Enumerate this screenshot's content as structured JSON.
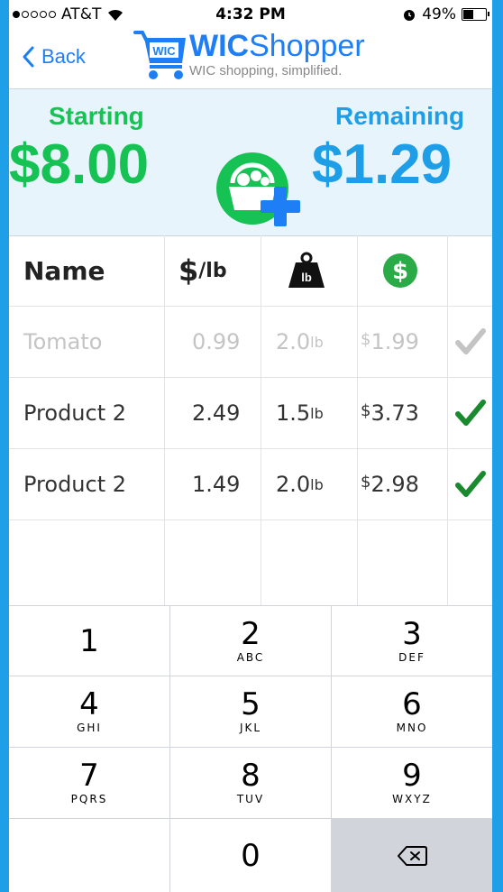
{
  "status": {
    "carrier": "AT&T",
    "time": "4:32 PM",
    "battery": "49%",
    "battery_level": 0.49
  },
  "nav": {
    "back_label": "Back",
    "logo_badge": "WIC",
    "title_bold": "WIC",
    "title_rest": "Shopper",
    "subtitle": "WIC shopping, simplified."
  },
  "budget": {
    "starting_label": "Starting",
    "starting_value": "$8.00",
    "remaining_label": "Remaining",
    "remaining_value": "$1.29"
  },
  "table": {
    "headers": {
      "name": "Name",
      "price_per_lb_symbol": "$",
      "price_per_lb_unit": "/lb",
      "weight_icon_label": "lb",
      "total_icon_label": "$"
    },
    "rows": [
      {
        "name": "Tomato",
        "price": "0.99",
        "weight": "2.0",
        "weight_unit": "lb",
        "total_symbol": "$",
        "total": "1.99",
        "checked": "inactive"
      },
      {
        "name": "Product 2",
        "price": "2.49",
        "weight": "1.5",
        "weight_unit": "lb",
        "total_symbol": "$",
        "total": "3.73",
        "checked": "active"
      },
      {
        "name": "Product 2",
        "price": "1.49",
        "weight": "2.0",
        "weight_unit": "lb",
        "total_symbol": "$",
        "total": "2.98",
        "checked": "active"
      }
    ]
  },
  "keypad": {
    "keys": [
      {
        "num": "1",
        "letters": ""
      },
      {
        "num": "2",
        "letters": "ABC"
      },
      {
        "num": "3",
        "letters": "DEF"
      },
      {
        "num": "4",
        "letters": "GHI"
      },
      {
        "num": "5",
        "letters": "JKL"
      },
      {
        "num": "6",
        "letters": "MNO"
      },
      {
        "num": "7",
        "letters": "PQRS"
      },
      {
        "num": "8",
        "letters": "TUV"
      },
      {
        "num": "9",
        "letters": "WXYZ"
      },
      {
        "num": "0",
        "letters": ""
      }
    ]
  },
  "colors": {
    "accent_blue": "#1e7ef6",
    "starting_green": "#17c254",
    "remaining_blue": "#1d9ee6",
    "check_green": "#1a8a2e",
    "frame_blue": "#1e9fe8"
  }
}
